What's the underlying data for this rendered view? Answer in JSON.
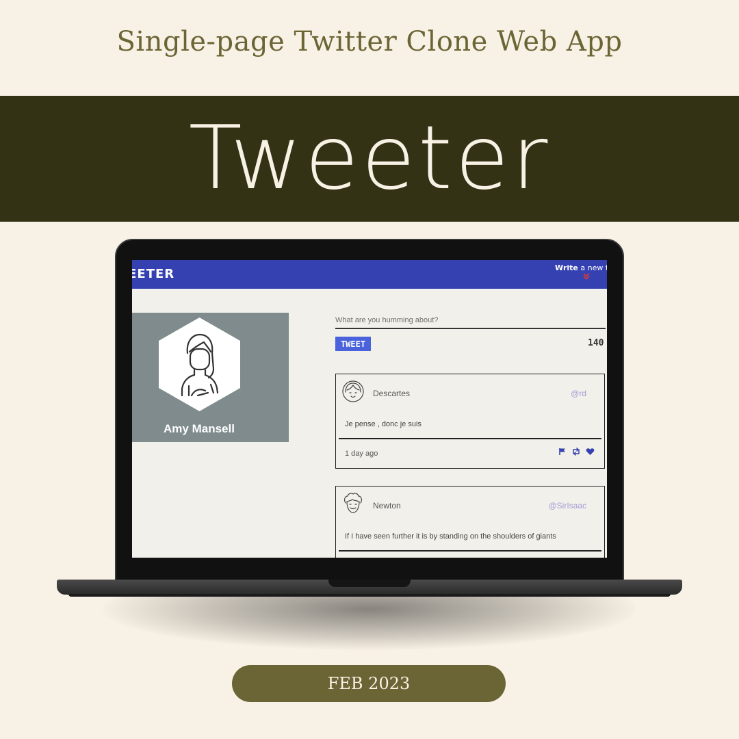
{
  "poster": {
    "subtitle": "Single-page Twitter Clone Web App",
    "title": "Tweeter",
    "date": "FEB 2023",
    "colors": {
      "background": "#f8f1e5",
      "banner": "#333214",
      "pill": "#6b6535",
      "accent_text": "#6b6535"
    }
  },
  "app": {
    "brand": "TWEETER",
    "header": {
      "write_bold": "Write",
      "write_rest": " a new tweet",
      "chevron_icon": "double-chevron-down-icon",
      "color": "#3541b0"
    },
    "profile": {
      "name": "Amy Mansell",
      "avatar_icon": "woman-avatar-icon"
    },
    "compose": {
      "placeholder": "What are you humming about?",
      "button_label": "TWEET",
      "counter": "140"
    },
    "tweets": [
      {
        "name": "Descartes",
        "handle": "@rd",
        "content": "Je pense , donc je suis",
        "time": "1 day ago",
        "avatar_icon": "girl-avatar-icon",
        "actions": [
          "flag-icon",
          "retweet-icon",
          "heart-icon"
        ]
      },
      {
        "name": "Newton",
        "handle": "@SirIsaac",
        "content": "If I have seen further it is by standing on the shoulders of giants",
        "avatar_icon": "curly-hair-avatar-icon"
      }
    ]
  }
}
